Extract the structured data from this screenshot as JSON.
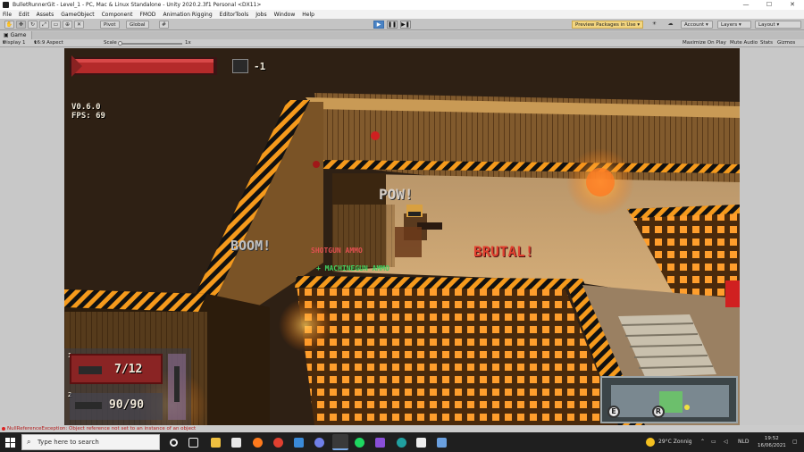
{
  "window": {
    "title": "BulletRunnerGit - Level_1 - PC, Mac & Linux Standalone - Unity 2020.2.3f1 Personal <DX11>",
    "controls": [
      "—",
      "☐",
      "✕"
    ]
  },
  "menu": [
    "File",
    "Edit",
    "Assets",
    "GameObject",
    "Component",
    "FMOD",
    "Animation Rigging",
    "EditorTools",
    "Jobs",
    "Window",
    "Help"
  ],
  "toolbar": {
    "pivot_label": "Pivot",
    "global_label": "Global",
    "preview_packages": "Preview Packages in Use",
    "account_label": "Account",
    "layers_label": "Layers",
    "layout_label": "Layout"
  },
  "game_view": {
    "tab_label": "Game",
    "display": "Display 1",
    "aspect": "16:9 Aspect",
    "scale_label": "Scale",
    "scale_value": "1x",
    "maximize": "Maximize On Play",
    "mute": "Mute Audio",
    "stats": "Stats",
    "gizmos": "Gizmos"
  },
  "hud": {
    "grenade_count": "-1",
    "version": "V0.6.0",
    "fps": "FPS: 69",
    "slot1_number": "1",
    "slot1_ammo": "7/12",
    "slot2_number": "2",
    "slot2_ammo": "90/90",
    "minimap_key_left": "E",
    "minimap_key_right": "R"
  },
  "popups": {
    "pow": "POW!",
    "boom": "BOOM!",
    "brutal": "BRUTAL!",
    "pickup1": "SHOTGUN AMMO",
    "pickup2": "+ MACHINEGUN AMMO"
  },
  "console_error": "NullReferenceException: Object reference not set to an instance of an object",
  "taskbar": {
    "search_placeholder": "Type here to search",
    "weather": "29°C  Zonnig",
    "language": "NLD",
    "time": "19:52",
    "date": "16/06/2021"
  },
  "colors": {
    "hazard_orange": "#f59a1c",
    "hazard_black": "#111111",
    "hud_red": "#b42a2a",
    "play_blue": "#4a83c4"
  }
}
